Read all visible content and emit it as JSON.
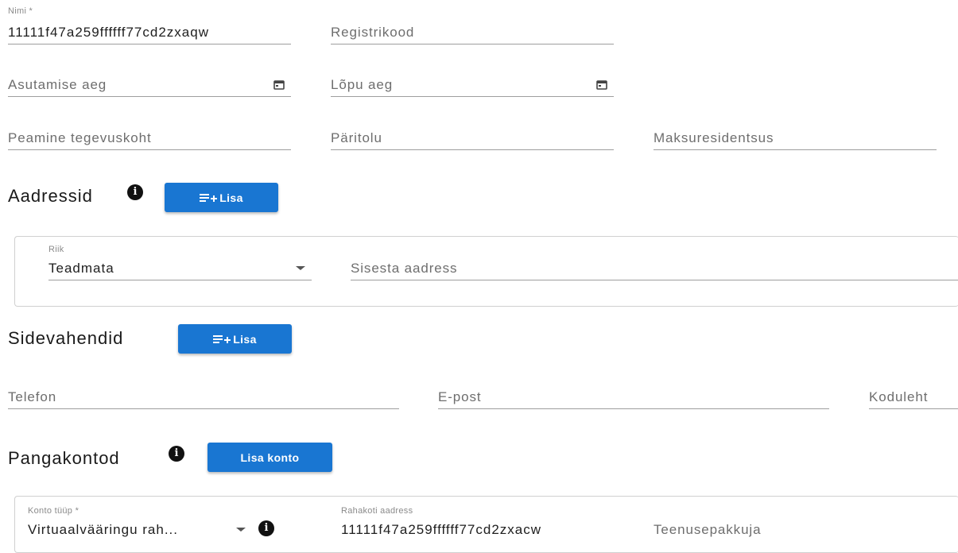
{
  "general": {
    "name": {
      "label": "Nimi *",
      "value": "11111f47a259ffffff77cd2zxaqw"
    },
    "registry_code": {
      "placeholder": "Registrikood"
    },
    "founding_date": {
      "placeholder": "Asutamise aeg",
      "icon": "calendar-icon"
    },
    "end_date": {
      "placeholder": "Lõpu aeg",
      "icon": "calendar-icon"
    },
    "main_activity_place": {
      "placeholder": "Peamine tegevuskoht"
    },
    "origin": {
      "placeholder": "Päritolu"
    },
    "tax_residency": {
      "placeholder": "Maksuresidentsus"
    }
  },
  "addresses": {
    "heading": "Aadressid",
    "add_button_label": "Lisa",
    "country": {
      "label": "Riik",
      "value": "Teadmata"
    },
    "address_input": {
      "placeholder": "Sisesta aadress"
    }
  },
  "contacts": {
    "heading": "Sidevahendid",
    "add_button_label": "Lisa",
    "phone": {
      "placeholder": "Telefon"
    },
    "email": {
      "placeholder": "E-post"
    },
    "website": {
      "placeholder": "Koduleht"
    }
  },
  "bank_accounts": {
    "heading": "Pangakontod",
    "add_button_label": "Lisa konto",
    "account_type": {
      "label": "Konto tüüp *",
      "value": "Virtuaalvääringu rah..."
    },
    "wallet_address": {
      "label": "Rahakoti aadress",
      "value": "11111f47a259ffffff77cd2zxacw"
    },
    "service_provider": {
      "placeholder": "Teenusepakkuja"
    }
  },
  "theme": {
    "primary": "#1976d2",
    "underline": "#9e9e9e"
  }
}
